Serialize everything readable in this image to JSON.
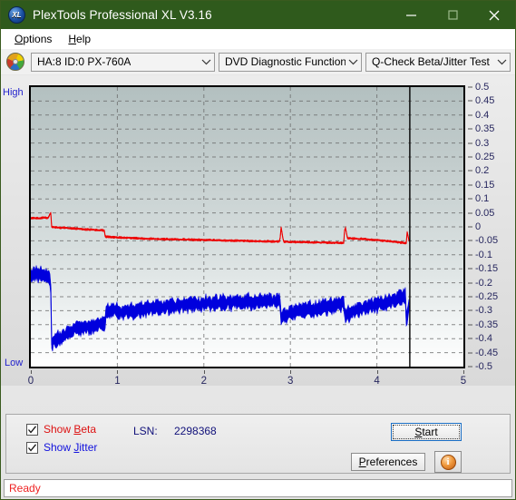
{
  "window": {
    "title": "PlexTools Professional XL V3.16",
    "logo_text": "XL",
    "minimize_label": "─",
    "maximize_label": "□",
    "close_label": "✕"
  },
  "menu": {
    "items": [
      {
        "label": "Options",
        "accel": "O"
      },
      {
        "label": "Help",
        "accel": "H"
      }
    ]
  },
  "toolbar": {
    "drive_select": "HA:8 ID:0  PX-760A",
    "function_select": "DVD Diagnostic Functions",
    "test_select": "Q-Check Beta/Jitter Test",
    "chevron": "∨"
  },
  "controls": {
    "show_beta_label": "Show Beta",
    "show_beta_checked": true,
    "show_jitter_label": "Show Jitter",
    "show_jitter_checked": true,
    "lsn_label": "LSN:",
    "lsn_value": "2298368",
    "start_label": "Start",
    "preferences_label": "Preferences",
    "info_label": "i"
  },
  "statusbar": {
    "text": "Ready"
  },
  "colors": {
    "titlebar": "#2f5a1c",
    "beta": "#ee0000",
    "jitter": "#0000dd",
    "axis_text": "#26265e",
    "highlow_text": "#2222cc",
    "status_text": "#ee2222"
  },
  "chart_data": {
    "type": "line",
    "title": "",
    "xlabel": "",
    "ylabel": "",
    "xlim": [
      0,
      5
    ],
    "ylim": [
      -0.5,
      0.5
    ],
    "grid": true,
    "legend": "none",
    "high_label": "High",
    "low_label": "Low",
    "x_ticks": [
      0,
      1,
      2,
      3,
      4,
      5
    ],
    "y_ticks": [
      0.5,
      0.45,
      0.4,
      0.35,
      0.3,
      0.25,
      0.2,
      0.15,
      0.1,
      0.05,
      0,
      -0.05,
      -0.1,
      -0.15,
      -0.2,
      -0.25,
      -0.3,
      -0.35,
      -0.4,
      -0.45,
      -0.5
    ],
    "data_end_x": 4.38,
    "series": [
      {
        "name": "Beta",
        "color": "#ee0000",
        "x": [
          0.0,
          0.05,
          0.1,
          0.15,
          0.2,
          0.23,
          0.24,
          0.3,
          0.4,
          0.5,
          0.6,
          0.7,
          0.8,
          0.85,
          0.86,
          0.95,
          1.1,
          1.25,
          1.4,
          1.55,
          1.7,
          1.85,
          2.0,
          2.15,
          2.3,
          2.45,
          2.6,
          2.75,
          2.88,
          2.89,
          2.92,
          3.05,
          3.2,
          3.35,
          3.5,
          3.62,
          3.63,
          3.66,
          3.8,
          3.95,
          4.1,
          4.25,
          4.34,
          4.35,
          4.38
        ],
        "y": [
          0.03,
          0.032,
          0.031,
          0.033,
          0.032,
          0.052,
          0.0,
          -0.002,
          -0.004,
          -0.006,
          -0.008,
          -0.01,
          -0.012,
          -0.013,
          -0.035,
          -0.037,
          -0.039,
          -0.041,
          -0.043,
          -0.044,
          -0.045,
          -0.046,
          -0.047,
          -0.048,
          -0.049,
          -0.05,
          -0.051,
          -0.052,
          -0.053,
          0.005,
          -0.053,
          -0.054,
          -0.055,
          -0.056,
          -0.057,
          -0.058,
          0.008,
          -0.04,
          -0.043,
          -0.046,
          -0.05,
          -0.055,
          -0.058,
          -0.018,
          -0.062
        ]
      },
      {
        "name": "Jitter",
        "color": "#0000dd",
        "x": [
          0.0,
          0.04,
          0.08,
          0.12,
          0.16,
          0.2,
          0.22,
          0.23,
          0.24,
          0.3,
          0.4,
          0.5,
          0.6,
          0.7,
          0.8,
          0.86,
          0.87,
          0.95,
          1.05,
          1.2,
          1.4,
          1.6,
          1.8,
          2.0,
          2.2,
          2.4,
          2.6,
          2.8,
          2.88,
          2.89,
          3.0,
          3.15,
          3.3,
          3.45,
          3.58,
          3.62,
          3.63,
          3.75,
          3.9,
          4.05,
          4.2,
          4.3,
          4.33,
          4.34,
          4.36,
          4.38
        ],
        "y": [
          -0.17,
          -0.168,
          -0.172,
          -0.175,
          -0.178,
          -0.182,
          -0.19,
          -0.205,
          -0.42,
          -0.4,
          -0.385,
          -0.37,
          -0.36,
          -0.355,
          -0.35,
          -0.348,
          -0.295,
          -0.3,
          -0.305,
          -0.3,
          -0.29,
          -0.285,
          -0.28,
          -0.275,
          -0.272,
          -0.27,
          -0.268,
          -0.265,
          -0.263,
          -0.32,
          -0.31,
          -0.3,
          -0.292,
          -0.285,
          -0.278,
          -0.274,
          -0.315,
          -0.3,
          -0.288,
          -0.275,
          -0.262,
          -0.25,
          -0.248,
          -0.33,
          -0.3,
          -0.27
        ]
      }
    ],
    "band": {
      "beta_noise": 0.004,
      "jitter_noise": 0.028
    }
  }
}
